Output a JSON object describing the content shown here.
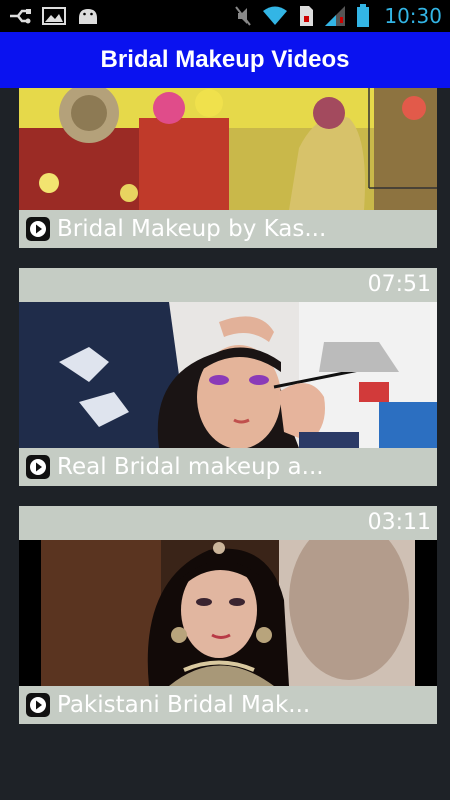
{
  "status_bar": {
    "icons_left": [
      "usb-icon",
      "gallery-icon",
      "android-icon"
    ],
    "icons_right": [
      "mute-icon",
      "wifi-icon",
      "sd-card-icon",
      "signal-icon",
      "battery-icon"
    ],
    "time": "10:30"
  },
  "action_bar": {
    "title": "Bridal Makeup Videos",
    "color": "#0a12f0"
  },
  "videos": [
    {
      "title": "Bridal Makeup by Kas...",
      "duration": ""
    },
    {
      "title": "Real Bridal makeup a...",
      "duration": "07:51"
    },
    {
      "title": "Pakistani Bridal Mak...",
      "duration": "03:11"
    }
  ]
}
